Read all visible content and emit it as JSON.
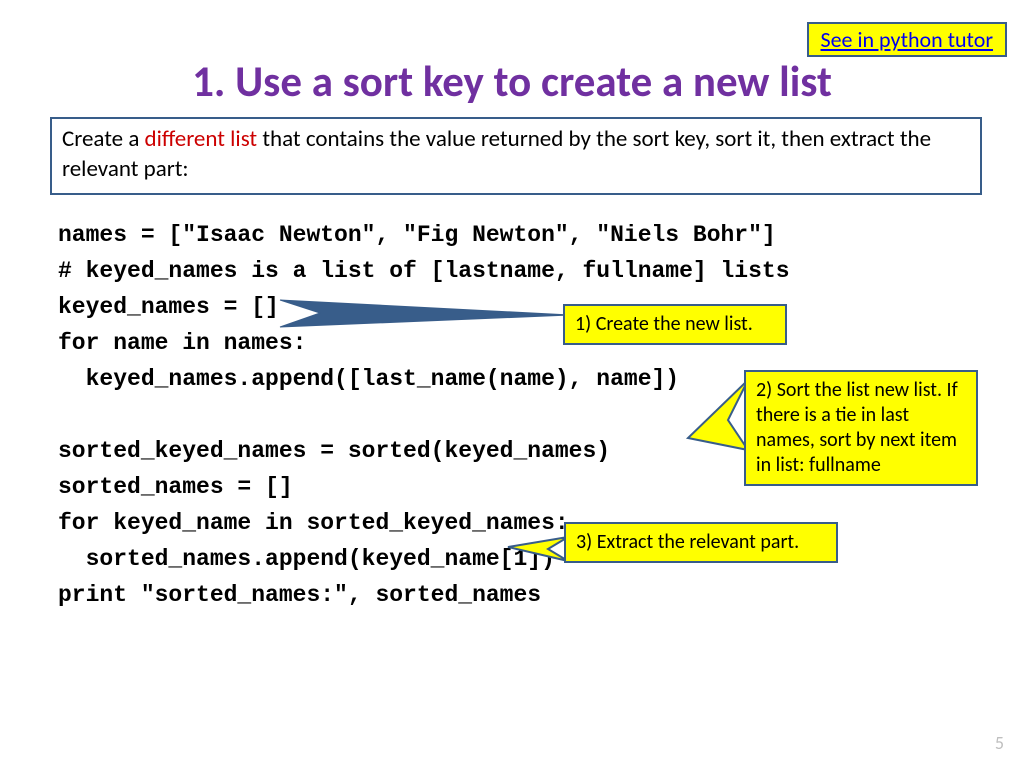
{
  "tutor_link": "See in python tutor",
  "title": "1. Use a sort key to create a new list",
  "intro": {
    "pre": "Create a ",
    "highlight": "different list",
    "post": " that contains the value returned by the sort key, sort it, then extract the relevant part:"
  },
  "code_lines": [
    "names = [\"Isaac Newton\", \"Fig Newton\", \"Niels Bohr\"]",
    "# keyed_names is a list of [lastname, fullname] lists",
    "keyed_names = []",
    "for name in names:",
    "  keyed_names.append([last_name(name), name])",
    "",
    "sorted_keyed_names = sorted(keyed_names)",
    "sorted_names = []",
    "for keyed_name in sorted_keyed_names:",
    "  sorted_names.append(keyed_name[1])",
    "print \"sorted_names:\", sorted_names"
  ],
  "callouts": {
    "c1": "1) Create the new list.",
    "c2": "2) Sort the list new list. If there is a tie in last names, sort by next item in list: fullname",
    "c3": "3) Extract the relevant part."
  },
  "page_number": "5"
}
